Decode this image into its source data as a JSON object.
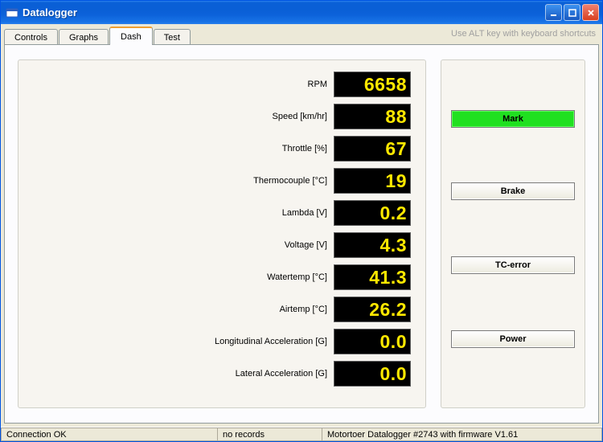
{
  "window": {
    "title": "Datalogger"
  },
  "hint": "Use ALT key with keyboard shortcuts",
  "tabs": {
    "controls": "Controls",
    "graphs": "Graphs",
    "dash": "Dash",
    "test": "Test"
  },
  "readouts": {
    "rpm": {
      "label": "RPM",
      "value": "6658"
    },
    "speed": {
      "label": "Speed [km/hr]",
      "value": "88"
    },
    "throttle": {
      "label": "Throttle [%]",
      "value": "67"
    },
    "tc": {
      "label": "Thermocouple [°C]",
      "value": "19"
    },
    "lambda": {
      "label": "Lambda [V]",
      "value": "0.2"
    },
    "voltage": {
      "label": "Voltage [V]",
      "value": "4.3"
    },
    "watertemp": {
      "label": "Watertemp [°C]",
      "value": "41.3"
    },
    "airtemp": {
      "label": "Airtemp [°C]",
      "value": "26.2"
    },
    "lonacc": {
      "label": "Longitudinal Acceleration [G]",
      "value": "0.0"
    },
    "latacc": {
      "label": "Lateral Acceleration [G]",
      "value": "0.0"
    }
  },
  "buttons": {
    "mark": "Mark",
    "brake": "Brake",
    "tcerror": "TC-error",
    "power": "Power"
  },
  "status": {
    "connection": "Connection OK",
    "records": "no records",
    "device": "Motortoer Datalogger #2743 with firmware V1.61"
  }
}
